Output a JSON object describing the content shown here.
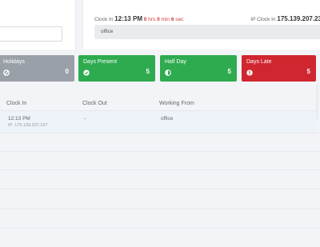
{
  "clock": {
    "label": "Clock In",
    "time": "12:13 PM",
    "duration_hrs": "0",
    "hrs_label": "hrs",
    "duration_min": "0",
    "min_label": "min",
    "duration_sec": "6",
    "sec_label": "sec",
    "ip_label": "IP Clock In",
    "ip_value": "175.139.207.23",
    "working_from": "office"
  },
  "stats": {
    "holidays": {
      "label": "Holidays",
      "count": "0",
      "color": "#9aa0a8",
      "icon": "ban-icon"
    },
    "present": {
      "label": "Days Present",
      "count": "5",
      "color": "#2eab4f",
      "icon": "check-circle-icon"
    },
    "halfday": {
      "label": "Half Day",
      "count": "5",
      "color": "#2eab4f",
      "icon": "half-circle-icon"
    },
    "late": {
      "label": "Days Late",
      "count": "5",
      "color": "#d0262f",
      "icon": "exclamation-circle-icon"
    }
  },
  "table": {
    "headers": [
      "Clock In",
      "Clock Out",
      "Working From"
    ],
    "rows": [
      {
        "clock_in": "12:13 PM",
        "ip": "IP: 175.139.207.237",
        "clock_out": "-",
        "working_from": "office"
      }
    ]
  }
}
